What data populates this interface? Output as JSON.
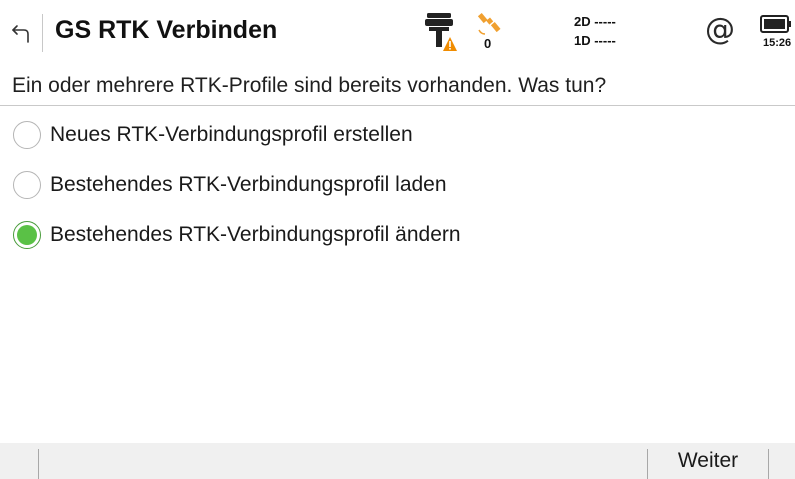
{
  "header": {
    "title": "GS RTK Verbinden",
    "satellite_count": "0",
    "precision_2d": "2D -----",
    "precision_1d": "1D -----",
    "time": "15:26",
    "icons": [
      "back-arrow-icon",
      "instrument-warning-icon",
      "satellite-icon",
      "at-icon",
      "battery-icon"
    ],
    "colors": {
      "warning": "#f08c00",
      "satellite": "#f0a030"
    }
  },
  "main": {
    "question": "Ein oder mehrere RTK-Profile sind bereits vorhanden. Was tun?",
    "options": [
      {
        "label": "Neues RTK-Verbindungsprofil erstellen",
        "selected": false
      },
      {
        "label": "Bestehendes RTK-Verbindungsprofil laden",
        "selected": false
      },
      {
        "label": "Bestehendes RTK-Verbindungsprofil ändern",
        "selected": true
      }
    ],
    "colors": {
      "selected_radio": "#5ac146"
    }
  },
  "footer": {
    "next_label": "Weiter"
  }
}
